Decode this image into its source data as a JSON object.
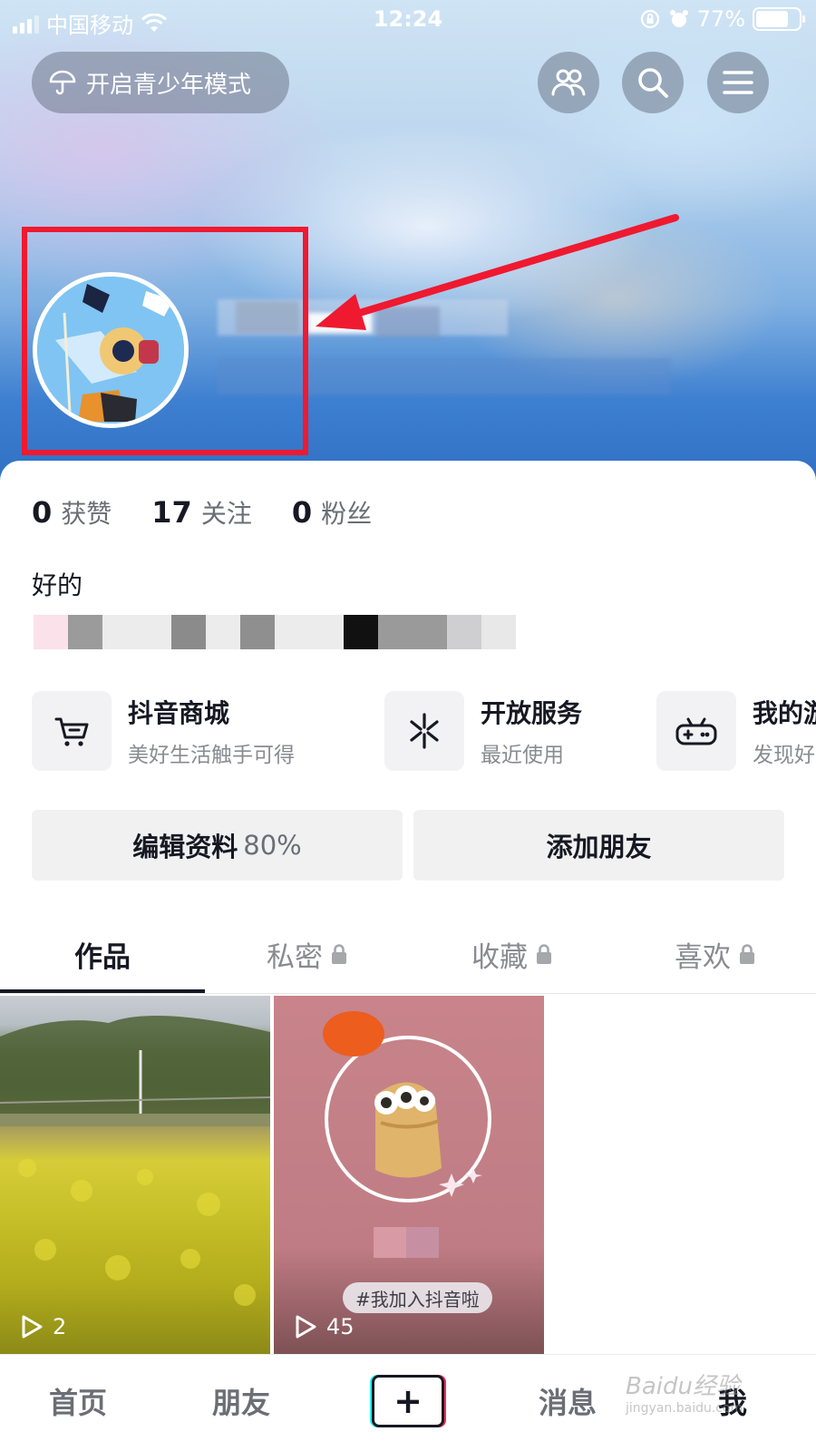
{
  "status_bar": {
    "carrier": "中国移动",
    "time": "12:24",
    "battery": "77%",
    "battery_level": 0.77
  },
  "header": {
    "teen_mode_label": "开启青少年模式"
  },
  "profile": {
    "stats": [
      {
        "value": "0",
        "label": "获赞"
      },
      {
        "value": "17",
        "label": "关注"
      },
      {
        "value": "0",
        "label": "粉丝"
      }
    ],
    "bio": "好的"
  },
  "services": [
    {
      "title": "抖音商城",
      "subtitle": "美好生活触手可得",
      "icon": "cart-icon"
    },
    {
      "title": "开放服务",
      "subtitle": "最近使用",
      "icon": "asterisk-icon"
    },
    {
      "title": "我的游",
      "subtitle": "发现好",
      "icon": "gamepad-icon"
    }
  ],
  "actions": {
    "edit_profile": "编辑资料",
    "edit_percent": "80%",
    "add_friend": "添加朋友"
  },
  "tabs": [
    {
      "label": "作品",
      "locked": false
    },
    {
      "label": "私密",
      "locked": true
    },
    {
      "label": "收藏",
      "locked": true
    },
    {
      "label": "喜欢",
      "locked": true
    }
  ],
  "videos": [
    {
      "plays": "2"
    },
    {
      "plays": "45",
      "tag": "#我加入抖音啦"
    }
  ],
  "bottom_nav": {
    "home": "首页",
    "friends": "朋友",
    "plus": "+",
    "messages": "消息",
    "me": "我"
  },
  "watermark": {
    "brand": "Baidu经验",
    "url": "jingyan.baidu.com"
  },
  "colors": {
    "highlight": "#ef1930",
    "accent_cyan": "#25f4ee",
    "accent_pink": "#fe2c55",
    "text_primary": "#161823"
  }
}
